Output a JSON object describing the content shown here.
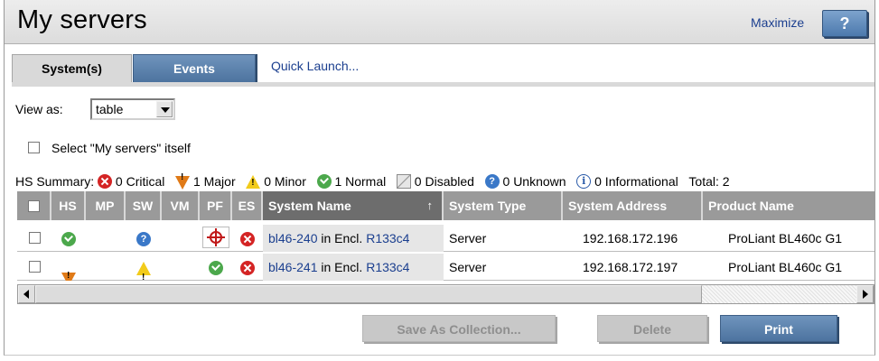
{
  "header": {
    "title": "My servers",
    "maximize_label": "Maximize",
    "help_label": "?"
  },
  "tabs": {
    "system": "System(s)",
    "events": "Events",
    "quick_launch": "Quick Launch..."
  },
  "view": {
    "label": "View as:",
    "selected": "table"
  },
  "select_self_label": "Select \"My servers\" itself",
  "summary": {
    "label": "HS Summary:",
    "critical": "0 Critical",
    "major": "1 Major",
    "minor": "0 Minor",
    "normal": "1 Normal",
    "disabled": "0 Disabled",
    "unknown": "0 Unknown",
    "informational": "0 Informational",
    "total": "Total: 2"
  },
  "table": {
    "columns": {
      "hs": "HS",
      "mp": "MP",
      "sw": "SW",
      "vm": "VM",
      "pf": "PF",
      "es": "ES",
      "system_name": "System Name",
      "system_type": "System Type",
      "system_address": "System Address",
      "product_name": "Product Name"
    },
    "sort_indicator": "↑",
    "rows": [
      {
        "hs": "normal",
        "sw": "unknown",
        "pf": "target",
        "es": "critical",
        "name": "bl46-240",
        "enclosure_text": "in Encl.",
        "enclosure": "R133c4",
        "type": "Server",
        "address": "192.168.172.196",
        "product": "ProLiant BL460c G1"
      },
      {
        "hs": "major",
        "sw": "minor",
        "pf": "normal",
        "es": "critical",
        "name": "bl46-241",
        "enclosure_text": "in Encl.",
        "enclosure": "R133c4",
        "type": "Server",
        "address": "192.168.172.197",
        "product": "ProLiant BL460c G1"
      }
    ]
  },
  "buttons": {
    "save_collection": "Save As Collection...",
    "delete": "Delete",
    "print": "Print"
  },
  "colors": {
    "tab_active": "#5b82ad",
    "link": "#1b3f8f",
    "header_bg": "#e4e4e4",
    "table_header": "#9a9a9a",
    "critical": "#d42424",
    "normal": "#4ca84c",
    "major": "#e07a17",
    "minor": "#f2cb1a",
    "unknown": "#3a78c8"
  }
}
